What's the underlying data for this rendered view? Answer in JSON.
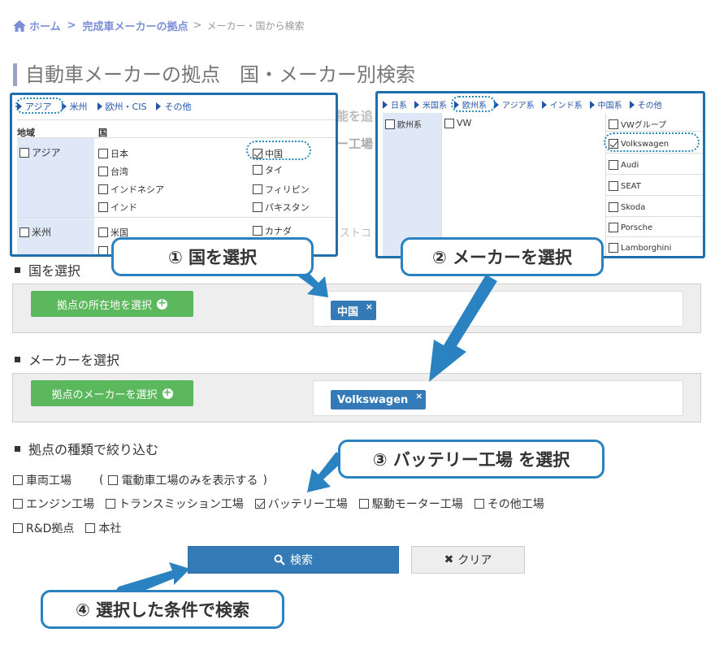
{
  "breadcrumb": {
    "home": "ホーム",
    "sep": ">",
    "section": "完成車メーカーの拠点",
    "current": "メーカー・国から検索"
  },
  "page_title": "自動車メーカーの拠点　国・メーカー別検索",
  "background_fragments": [
    "能を追",
    "ー工場",
    "ストコ"
  ],
  "country_section": {
    "heading": "国を選択",
    "button": "拠点の所在地を選択",
    "selected_tag": "中国",
    "tag_close": "×"
  },
  "maker_section": {
    "heading": "メーカーを選択",
    "button": "拠点のメーカーを選択",
    "selected_tag": "Volkswagen",
    "tag_close": "×"
  },
  "type_section": {
    "heading": "拠点の種類で絞り込む",
    "row1": [
      {
        "label": "車両工場",
        "checked": false
      }
    ],
    "ev_filter": {
      "open": "(",
      "label": "電動車工場のみを表示する",
      "close": ")",
      "checked": false
    },
    "row2": [
      {
        "label": "エンジン工場",
        "checked": false
      },
      {
        "label": "トランスミッション工場",
        "checked": false
      },
      {
        "label": "バッテリー工場",
        "checked": true
      },
      {
        "label": "駆動モーター工場",
        "checked": false
      },
      {
        "label": "その他工場",
        "checked": false
      }
    ],
    "row3": [
      {
        "label": "R&D拠点",
        "checked": false
      },
      {
        "label": "本社",
        "checked": false
      }
    ]
  },
  "actions": {
    "search": "検索",
    "clear": "クリア"
  },
  "country_popup": {
    "tabs": [
      "アジア",
      "米州",
      "欧州・CIS",
      "その他"
    ],
    "col_headers": {
      "region": "地域",
      "country": "国"
    },
    "regions": [
      {
        "name": "アジア",
        "checked": false,
        "countries": [
          {
            "name": "日本",
            "checked": false
          },
          {
            "name": "中国",
            "checked": true
          },
          {
            "name": "台湾",
            "checked": false
          },
          {
            "name": "タイ",
            "checked": false
          },
          {
            "name": "インドネシア",
            "checked": false
          },
          {
            "name": "フィリピン",
            "checked": false
          },
          {
            "name": "インド",
            "checked": false
          },
          {
            "name": "パキスタン",
            "checked": false
          }
        ]
      },
      {
        "name": "米州",
        "checked": false,
        "countries": [
          {
            "name": "米国",
            "checked": false
          },
          {
            "name": "カナダ",
            "checked": false
          }
        ]
      }
    ]
  },
  "maker_popup": {
    "tabs": [
      "日系",
      "米国系",
      "欧州系",
      "アジア系",
      "インド系",
      "中国系",
      "その他"
    ],
    "group": {
      "name": "欧州系",
      "checked": false
    },
    "subgroup": {
      "name": "VW",
      "checked": false
    },
    "makers": [
      {
        "name": "VWグループ",
        "checked": false
      },
      {
        "name": "Volkswagen",
        "checked": true
      },
      {
        "name": "Audi",
        "checked": false
      },
      {
        "name": "SEAT",
        "checked": false
      },
      {
        "name": "Skoda",
        "checked": false
      },
      {
        "name": "Porsche",
        "checked": false
      },
      {
        "name": "Lamborghini",
        "checked": false
      }
    ]
  },
  "callouts": {
    "step1": "① 国を選択",
    "step2": "② メーカーを選択",
    "step3": "③ バッテリー工場 を選択",
    "step4": "④ 選択した条件で検索"
  },
  "colors": {
    "primary": "#337ab7",
    "success": "#5cb85c",
    "callout_border": "#2a82c0",
    "popup_border": "#1d6fae"
  }
}
